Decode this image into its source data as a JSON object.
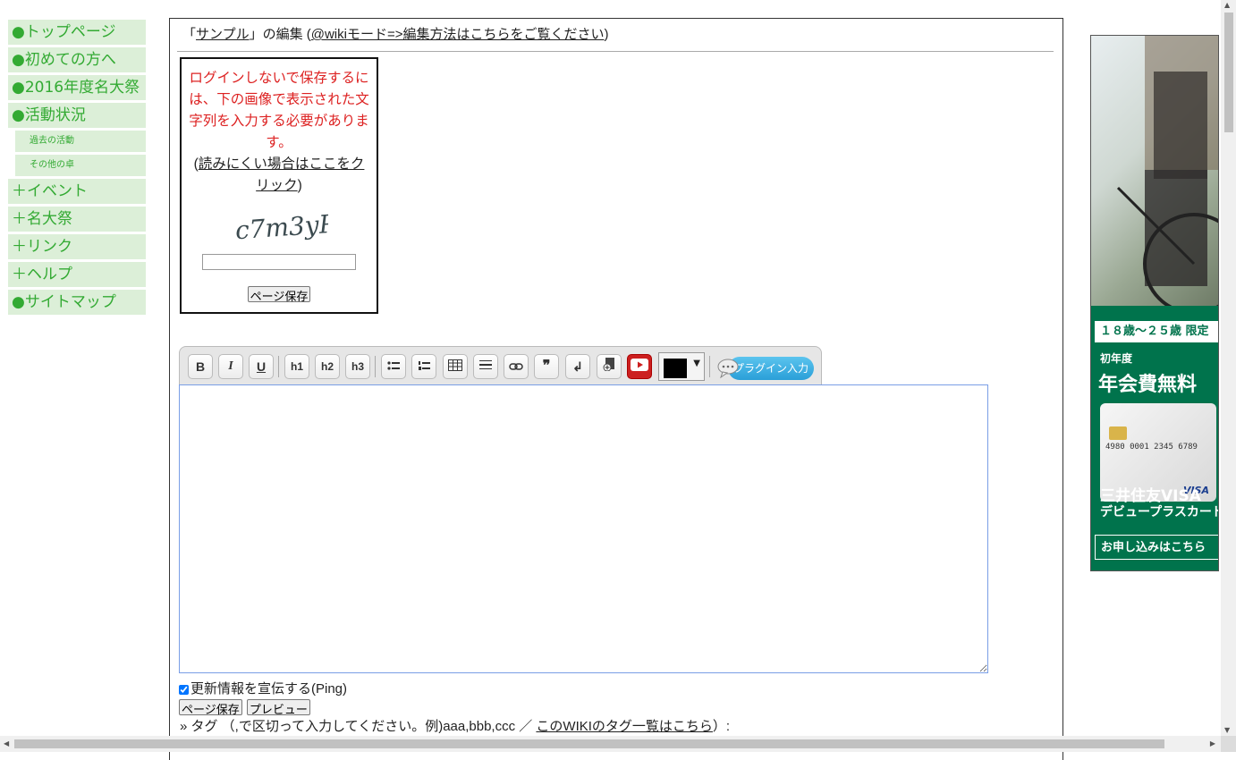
{
  "sidebar": {
    "items": [
      {
        "label": "●トップページ"
      },
      {
        "label": "●初めての方へ"
      },
      {
        "label": "●2016年度名大祭"
      },
      {
        "label": "●活動状況"
      }
    ],
    "subitems": [
      {
        "label": "過去の活動"
      },
      {
        "label": "その他の卓"
      }
    ],
    "items2": [
      {
        "label": "＋イベント"
      },
      {
        "label": "＋名大祭"
      },
      {
        "label": "＋リンク"
      },
      {
        "label": "＋ヘルプ"
      },
      {
        "label": "●サイトマップ"
      }
    ]
  },
  "edit_header": {
    "open_quote": "「",
    "page_link": "サンプル",
    "suffix": "」の編集 (",
    "mode_link": "@wikiモード=>編集方法はこちらをご覧ください",
    "close": ")"
  },
  "captcha": {
    "message": "ログインしないで保存するには、下の画像で表示された文字列を入力する必要があります。",
    "help_open": "(",
    "help_link": "読みにくい場合はここをクリック",
    "help_close": ")",
    "image_text": "c7m3yP",
    "input_value": "",
    "save_label": "ページ保存"
  },
  "toolbar": {
    "buttons": [
      {
        "label": "B",
        "icon": "bold-icon"
      },
      {
        "label": "I",
        "icon": "italic-icon"
      },
      {
        "label": "U",
        "icon": "underline-icon"
      },
      {
        "label": "h1",
        "icon": "heading1-icon"
      },
      {
        "label": "h2",
        "icon": "heading2-icon"
      },
      {
        "label": "h3",
        "icon": "heading3-icon"
      }
    ],
    "color_value": "#000000",
    "plugin_label": "プラグイン入力"
  },
  "editor": {
    "value": ""
  },
  "ping": {
    "label": "更新情報を宣伝する(Ping)",
    "checked": true
  },
  "buttons": {
    "save_label": "ページ保存",
    "preview_label": "プレビュー"
  },
  "tags": {
    "prefix": "» タグ （,で区切って入力してください。例)aaa,bbb,ccc ／ ",
    "link": "このWIKIのタグ一覧はこちら",
    "suffix": "）:"
  },
  "ad": {
    "banner": "１８歳～２５歳 限定",
    "year": "初年度",
    "headline": "年会費無料",
    "card_number": "4980 0001 2345 6789",
    "card_brand": "VISA",
    "brand_line1": "三井住友VISA",
    "brand_line2": "デビュープラスカード",
    "cta": "お申し込みはこちら"
  }
}
